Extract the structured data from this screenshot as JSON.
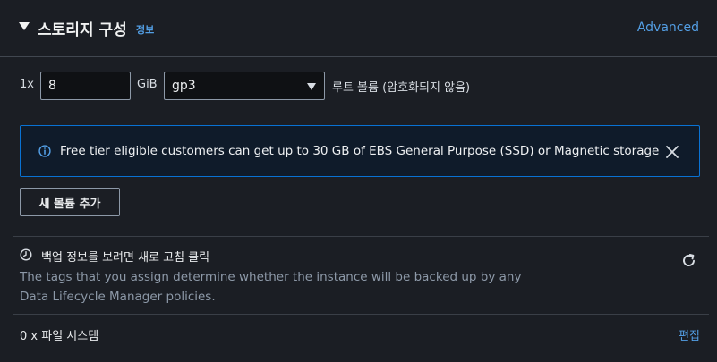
{
  "header": {
    "title": "스토리지 구성",
    "info_link": "정보",
    "advanced_link": "Advanced"
  },
  "volume": {
    "count_label": "1x",
    "size_value": "8",
    "size_unit": "GiB",
    "type_value": "gp3",
    "description": "루트 볼륨  (암호화되지 않음)"
  },
  "alert": {
    "message": "Free tier eligible customers can get up to 30 GB of EBS General Purpose (SSD) or Magnetic storage",
    "icon": "info-icon",
    "close_icon": "close-icon"
  },
  "add_volume_button": "새 볼륨 추가",
  "backup": {
    "heading": "백업 정보를 보려면 새로 고침 클릭",
    "description": "The tags that you assign determine whether the instance will be backed up by any Data Lifecycle Manager policies.",
    "icon": "clock-icon",
    "refresh_icon": "refresh-icon"
  },
  "file_systems": {
    "label": "0 x 파일 시스템",
    "edit_link": "편집"
  },
  "colors": {
    "background": "#1b1e24",
    "link": "#539fe5",
    "alert_border": "#0972d3",
    "alert_background": "#0f1b2a"
  }
}
